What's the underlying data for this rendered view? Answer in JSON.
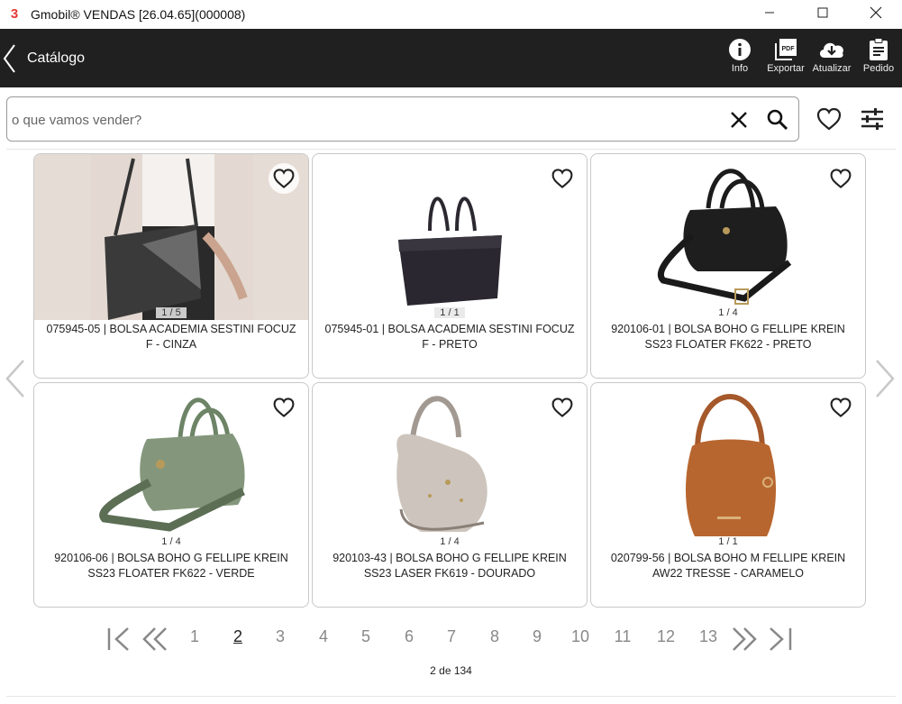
{
  "window": {
    "title": "Gmobil® VENDAS [26.04.65](000008)",
    "app_icon_glyph": "3"
  },
  "header": {
    "title": "Catálogo",
    "actions": [
      {
        "label": "Info",
        "icon": "info-icon"
      },
      {
        "label": "Exportar",
        "icon": "pdf-icon"
      },
      {
        "label": "Atualizar",
        "icon": "cloud-download-icon"
      },
      {
        "label": "Pedido",
        "icon": "clipboard-icon"
      }
    ]
  },
  "search": {
    "placeholder": "o que vamos vender?",
    "value": ""
  },
  "products": [
    {
      "name": "075945-05 | BOLSA ACADEMIA SESTINI FOCUZ F - CINZA",
      "counter": "1 / 5"
    },
    {
      "name": "075945-01 | BOLSA ACADEMIA SESTINI FOCUZ F - PRETO",
      "counter": "1 / 1"
    },
    {
      "name": "920106-01 | BOLSA BOHO G FELLIPE KREIN SS23 FLOATER FK622 - PRETO",
      "counter": "1 / 4"
    },
    {
      "name": "920106-06 | BOLSA BOHO G FELLIPE KREIN SS23 FLOATER FK622 - VERDE",
      "counter": "1 / 4"
    },
    {
      "name": "920103-43 | BOLSA BOHO G FELLIPE KREIN SS23 LASER FK619 - DOURADO",
      "counter": "1 / 4"
    },
    {
      "name": "020799-56 | BOLSA BOHO M FELLIPE KREIN AW22 TRESSE - CARAMELO",
      "counter": "1 / 1"
    }
  ],
  "pagination": {
    "pages": [
      "1",
      "2",
      "3",
      "4",
      "5",
      "6",
      "7",
      "8",
      "9",
      "10",
      "11",
      "12",
      "13"
    ],
    "current": "2",
    "status": "2 de 134"
  },
  "colors": {
    "header_bg": "#202020",
    "accent_red": "#e53935"
  }
}
